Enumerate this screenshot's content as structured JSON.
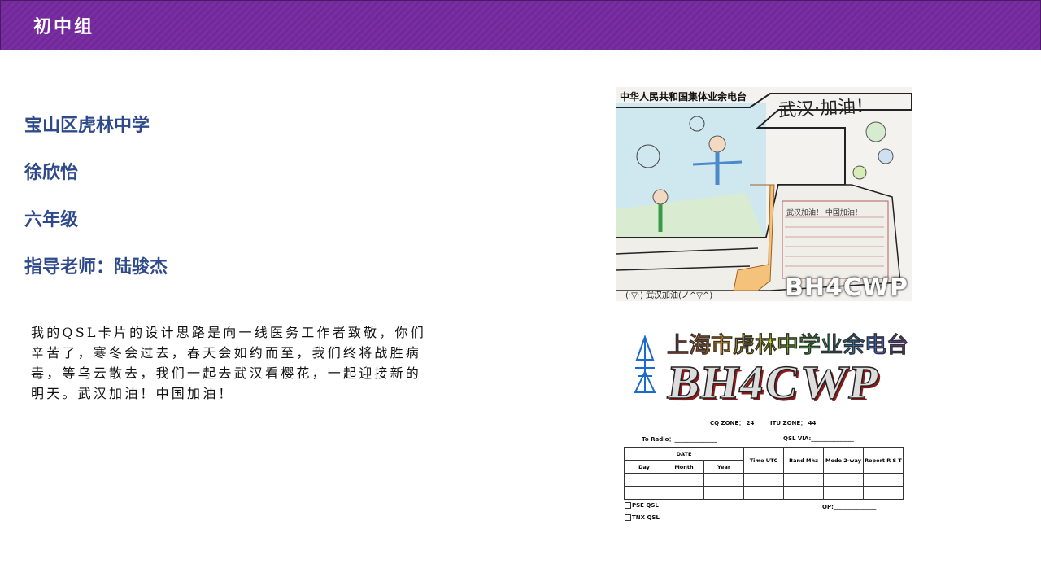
{
  "header": {
    "title": "初中组"
  },
  "info": {
    "school": "宝山区虎林中学",
    "student": "徐欣怡",
    "grade": "六年级",
    "teacher": "指导老师：陆骏杰"
  },
  "essay": "我的QSL卡片的设计思路是向一线医务工作者致敬，你们辛苦了，寒冬会过去，春天会如约而至，我们终将战胜病毒，等乌云散去，我们一起去武汉看樱花，一起迎接新的明天。武汉加油！中国加油！",
  "drawing": {
    "title": "中华人民共和国集体业余电台",
    "slogan": "武汉·加油！",
    "note": "武汉加油！ 中国加油！",
    "signature": "(·▽·) 武汉加油(ノ^▽^)",
    "callsign": "BH4CWP"
  },
  "qsl": {
    "station": "上海市虎林中学业余电台",
    "callsign": "BH4CWP",
    "cq_zone": "CQ ZONE： 24",
    "itu_zone": "ITU ZONE： 44",
    "to_radio": "To Radio：_______________",
    "qsl_via": "QSL VIA:_______________",
    "headers": {
      "date": "DATE",
      "day": "Day",
      "month": "Month",
      "year": "Year",
      "time": "Time UTC",
      "band": "Band Mhz",
      "mode": "Mode 2-way",
      "report": "Report R S T"
    },
    "pse": "PSE QSL",
    "tnx": "TNX QSL",
    "op": "OP:_______________"
  }
}
